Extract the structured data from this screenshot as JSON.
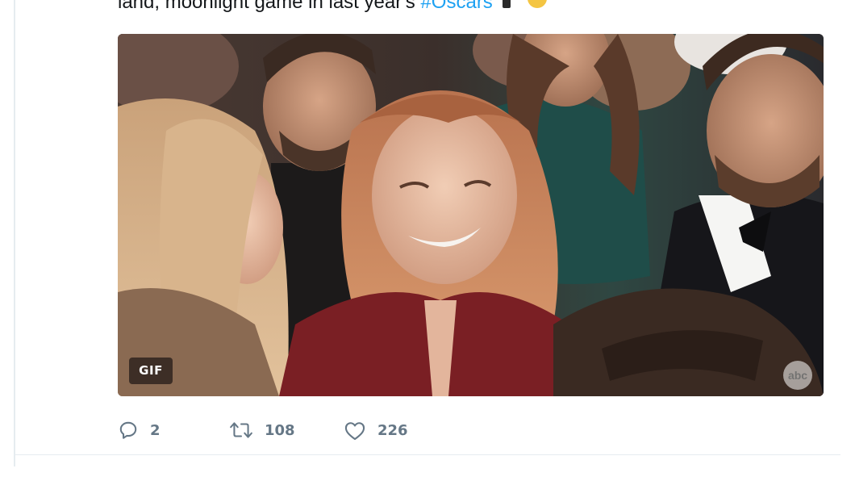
{
  "tweet": {
    "text_visible": "land, moonlight game in last year's",
    "hashtag": "#Oscars"
  },
  "media": {
    "badge": "GIF",
    "watermark": "abc"
  },
  "actions": {
    "reply": {
      "icon": "reply-bubble-icon",
      "count": "2"
    },
    "retweet": {
      "icon": "retweet-icon",
      "count": "108"
    },
    "like": {
      "icon": "heart-icon",
      "count": "226"
    }
  },
  "colors": {
    "link": "#1da1f2",
    "action_gray": "#657786",
    "divider": "#e6ecf0"
  }
}
